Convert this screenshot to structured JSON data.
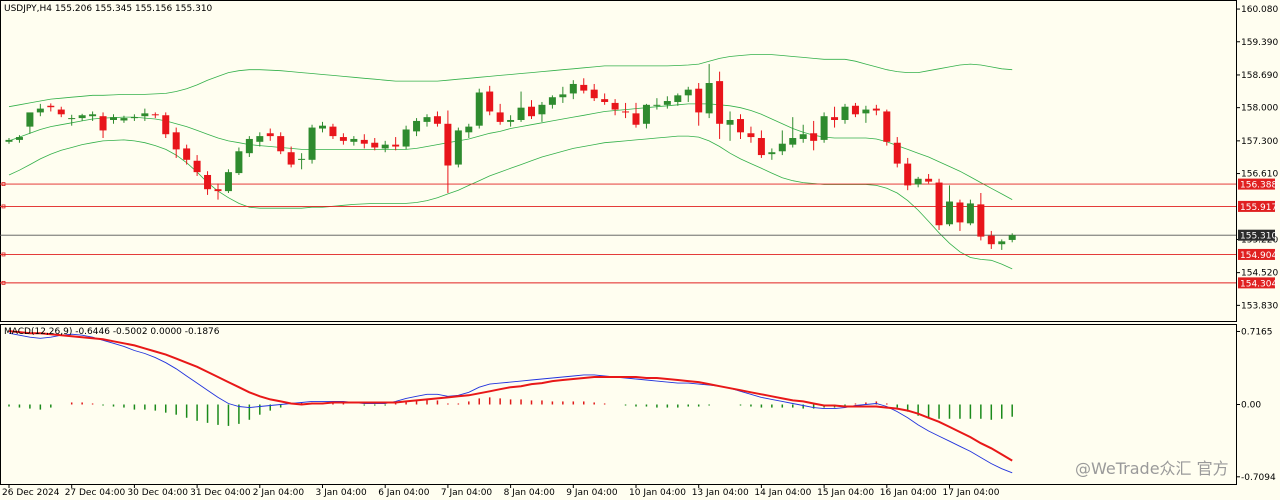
{
  "symbol_header": "USDJPY,H4  155.206 155.345 155.156 155.310",
  "macd_header": "MACD(12,26,9) -0.6446 -0.5002 0.0000 -0.1876",
  "watermark": "@WeTrade众汇 官方",
  "colors": {
    "background": "#fffef0",
    "bull": "#2e8b2e",
    "bear": "#e8151b",
    "band": "#33b04a",
    "level": "#e02020",
    "last_line": "#555555",
    "macd_main": "#2233dd",
    "macd_signal": "#e81818",
    "macd_hist": "#1a8a1a",
    "macd_hist_pos": "#e01818"
  },
  "chart_data": {
    "type": "candlestick",
    "price_axis": {
      "labels": [
        "160.080",
        "159.390",
        "158.690",
        "158.000",
        "157.300",
        "156.610",
        "155.220",
        "154.520",
        "153.830"
      ],
      "values": [
        160.08,
        159.39,
        158.69,
        158.0,
        157.3,
        156.61,
        155.22,
        154.52,
        153.83
      ],
      "range": [
        153.5,
        160.25
      ]
    },
    "time_labels": [
      "26 Dec 2024",
      "27 Dec 04:00",
      "30 Dec 04:00",
      "31 Dec 04:00",
      "2 Jan 04:00",
      "3 Jan 04:00",
      "6 Jan 04:00",
      "7 Jan 04:00",
      "8 Jan 04:00",
      "9 Jan 04:00",
      "10 Jan 04:00",
      "13 Jan 04:00",
      "14 Jan 04:00",
      "15 Jan 04:00",
      "16 Jan 04:00",
      "17 Jan 04:00"
    ],
    "candles": [
      [
        157.28,
        157.36,
        157.24,
        157.32
      ],
      [
        157.32,
        157.42,
        157.26,
        157.38
      ],
      [
        157.6,
        157.7,
        157.45,
        157.9
      ],
      [
        157.9,
        158.08,
        157.82,
        157.98
      ],
      [
        158.04,
        158.09,
        157.92,
        158.01
      ],
      [
        157.96,
        158.02,
        157.8,
        157.86
      ],
      [
        157.77,
        157.85,
        157.62,
        157.78
      ],
      [
        157.78,
        157.87,
        157.72,
        157.84
      ],
      [
        157.82,
        157.92,
        157.72,
        157.86
      ],
      [
        157.82,
        157.9,
        157.36,
        157.52
      ],
      [
        157.74,
        157.86,
        157.66,
        157.8
      ],
      [
        157.73,
        157.83,
        157.68,
        157.78
      ],
      [
        157.78,
        157.86,
        157.72,
        157.8
      ],
      [
        157.82,
        157.98,
        157.72,
        157.88
      ],
      [
        157.86,
        157.9,
        157.78,
        157.84
      ],
      [
        157.84,
        157.9,
        157.36,
        157.44
      ],
      [
        157.48,
        157.58,
        156.94,
        157.12
      ],
      [
        157.14,
        157.22,
        156.8,
        156.9
      ],
      [
        156.88,
        157.0,
        156.56,
        156.64
      ],
      [
        156.58,
        156.66,
        156.16,
        156.28
      ],
      [
        156.28,
        156.4,
        156.06,
        156.24
      ],
      [
        156.24,
        156.7,
        156.2,
        156.64
      ],
      [
        156.62,
        157.16,
        156.58,
        157.08
      ],
      [
        157.04,
        157.4,
        156.96,
        157.34
      ],
      [
        157.28,
        157.48,
        157.18,
        157.4
      ],
      [
        157.46,
        157.56,
        157.3,
        157.4
      ],
      [
        157.4,
        157.48,
        157.02,
        157.08
      ],
      [
        157.06,
        157.18,
        156.74,
        156.8
      ],
      [
        156.9,
        157.04,
        156.7,
        156.92
      ],
      [
        156.9,
        157.64,
        156.82,
        157.58
      ],
      [
        157.56,
        157.7,
        157.48,
        157.62
      ],
      [
        157.6,
        157.66,
        157.34,
        157.4
      ],
      [
        157.38,
        157.46,
        157.22,
        157.3
      ],
      [
        157.28,
        157.4,
        157.2,
        157.34
      ],
      [
        157.32,
        157.44,
        157.14,
        157.24
      ],
      [
        157.26,
        157.36,
        157.1,
        157.16
      ],
      [
        157.14,
        157.3,
        157.06,
        157.22
      ],
      [
        157.22,
        157.38,
        157.1,
        157.18
      ],
      [
        157.18,
        157.62,
        157.12,
        157.54
      ],
      [
        157.5,
        157.78,
        157.4,
        157.72
      ],
      [
        157.7,
        157.86,
        157.6,
        157.8
      ],
      [
        157.82,
        157.92,
        157.6,
        157.66
      ],
      [
        157.66,
        157.94,
        156.2,
        156.78
      ],
      [
        156.8,
        157.58,
        156.74,
        157.52
      ],
      [
        157.48,
        157.66,
        157.36,
        157.6
      ],
      [
        157.62,
        158.4,
        157.56,
        158.32
      ],
      [
        158.34,
        158.46,
        157.84,
        157.92
      ],
      [
        157.9,
        158.08,
        157.64,
        157.7
      ],
      [
        157.7,
        157.84,
        157.6,
        157.74
      ],
      [
        157.74,
        158.34,
        157.7,
        158.0
      ],
      [
        158.02,
        158.16,
        157.76,
        157.82
      ],
      [
        157.86,
        158.12,
        157.7,
        158.06
      ],
      [
        158.06,
        158.26,
        157.98,
        158.22
      ],
      [
        158.22,
        158.44,
        158.1,
        158.28
      ],
      [
        158.3,
        158.58,
        158.18,
        158.5
      ],
      [
        158.48,
        158.62,
        158.3,
        158.36
      ],
      [
        158.38,
        158.5,
        158.14,
        158.2
      ],
      [
        158.18,
        158.3,
        158.06,
        158.12
      ],
      [
        158.1,
        158.18,
        157.84,
        157.96
      ],
      [
        157.92,
        158.1,
        157.78,
        157.9
      ],
      [
        157.88,
        158.1,
        157.58,
        157.64
      ],
      [
        157.66,
        158.08,
        157.56,
        158.06
      ],
      [
        158.04,
        158.2,
        157.96,
        158.06
      ],
      [
        158.06,
        158.24,
        157.98,
        158.14
      ],
      [
        158.12,
        158.3,
        158.04,
        158.26
      ],
      [
        158.26,
        158.44,
        158.12,
        158.38
      ],
      [
        158.4,
        158.52,
        157.62,
        157.9
      ],
      [
        157.88,
        158.92,
        157.78,
        158.52
      ],
      [
        158.56,
        158.76,
        157.34,
        157.66
      ],
      [
        157.64,
        157.92,
        157.3,
        157.74
      ],
      [
        157.76,
        157.86,
        157.34,
        157.48
      ],
      [
        157.46,
        157.6,
        157.26,
        157.38
      ],
      [
        157.36,
        157.52,
        156.94,
        157.0
      ],
      [
        157.02,
        157.14,
        156.9,
        157.06
      ],
      [
        157.08,
        157.52,
        157.0,
        157.24
      ],
      [
        157.22,
        157.8,
        157.16,
        157.36
      ],
      [
        157.34,
        157.64,
        157.26,
        157.44
      ],
      [
        157.46,
        157.72,
        157.1,
        157.3
      ],
      [
        157.32,
        157.9,
        157.26,
        157.82
      ],
      [
        157.8,
        158.02,
        157.58,
        157.74
      ],
      [
        157.74,
        158.08,
        157.66,
        158.02
      ],
      [
        158.04,
        158.1,
        157.8,
        157.86
      ],
      [
        157.88,
        158.04,
        157.68,
        157.96
      ],
      [
        157.98,
        158.06,
        157.84,
        157.94
      ],
      [
        157.92,
        157.96,
        157.2,
        157.28
      ],
      [
        157.26,
        157.38,
        156.74,
        156.82
      ],
      [
        156.82,
        156.94,
        156.26,
        156.36
      ],
      [
        156.38,
        156.54,
        156.32,
        156.5
      ],
      [
        156.5,
        156.6,
        156.4,
        156.44
      ],
      [
        156.42,
        156.5,
        155.42,
        155.52
      ],
      [
        155.54,
        156.36,
        155.5,
        156.02
      ],
      [
        156.0,
        156.06,
        155.4,
        155.58
      ],
      [
        155.56,
        156.06,
        155.52,
        155.98
      ],
      [
        155.96,
        156.2,
        155.2,
        155.28
      ],
      [
        155.3,
        155.4,
        155.02,
        155.12
      ],
      [
        155.12,
        155.22,
        155.0,
        155.18
      ],
      [
        155.21,
        155.35,
        155.16,
        155.31
      ]
    ],
    "bollinger_bands": {
      "period": 20,
      "upper": [
        158.02,
        158.06,
        158.1,
        158.14,
        158.18,
        158.2,
        158.22,
        158.24,
        158.26,
        158.26,
        158.27,
        158.28,
        158.28,
        158.28,
        158.29,
        158.3,
        158.34,
        158.4,
        158.48,
        158.58,
        158.66,
        158.74,
        158.78,
        158.8,
        158.8,
        158.79,
        158.78,
        158.76,
        158.74,
        158.72,
        158.7,
        158.68,
        158.66,
        158.64,
        158.62,
        158.6,
        158.58,
        158.56,
        158.56,
        158.56,
        158.56,
        158.56,
        158.58,
        158.6,
        158.62,
        158.64,
        158.66,
        158.68,
        158.7,
        158.72,
        158.74,
        158.76,
        158.78,
        158.8,
        158.82,
        158.84,
        158.86,
        158.88,
        158.88,
        158.88,
        158.88,
        158.88,
        158.88,
        158.88,
        158.89,
        158.9,
        158.92,
        158.98,
        159.04,
        159.08,
        159.1,
        159.12,
        159.12,
        159.12,
        159.1,
        159.08,
        159.06,
        159.04,
        159.02,
        159.02,
        159.02,
        158.98,
        158.92,
        158.86,
        158.8,
        158.76,
        158.74,
        158.74,
        158.78,
        158.82,
        158.86,
        158.9,
        158.92,
        158.9,
        158.86,
        158.82,
        158.8
      ],
      "middle": [
        157.3,
        157.38,
        157.46,
        157.54,
        157.6,
        157.64,
        157.68,
        157.72,
        157.76,
        157.78,
        157.79,
        157.8,
        157.8,
        157.78,
        157.76,
        157.72,
        157.66,
        157.6,
        157.52,
        157.44,
        157.36,
        157.3,
        157.26,
        157.22,
        157.2,
        157.18,
        157.16,
        157.14,
        157.12,
        157.12,
        157.12,
        157.12,
        157.12,
        157.12,
        157.12,
        157.12,
        157.12,
        157.12,
        157.12,
        157.14,
        157.18,
        157.22,
        157.26,
        157.3,
        157.34,
        157.4,
        157.46,
        157.5,
        157.56,
        157.6,
        157.64,
        157.68,
        157.72,
        157.76,
        157.8,
        157.84,
        157.88,
        157.92,
        157.94,
        157.96,
        157.98,
        158.0,
        158.02,
        158.04,
        158.06,
        158.08,
        158.08,
        158.08,
        158.06,
        158.04,
        158.0,
        157.94,
        157.86,
        157.76,
        157.66,
        157.56,
        157.48,
        157.42,
        157.38,
        157.36,
        157.36,
        157.36,
        157.36,
        157.34,
        157.28,
        157.2,
        157.12,
        157.04,
        156.96,
        156.86,
        156.76,
        156.66,
        156.54,
        156.42,
        156.3,
        156.18,
        156.06
      ],
      "lower": [
        156.58,
        156.68,
        156.8,
        156.92,
        157.02,
        157.1,
        157.16,
        157.22,
        157.26,
        157.3,
        157.31,
        157.32,
        157.3,
        157.26,
        157.2,
        157.12,
        157.0,
        156.84,
        156.64,
        156.42,
        156.24,
        156.1,
        155.98,
        155.9,
        155.88,
        155.88,
        155.88,
        155.88,
        155.88,
        155.9,
        155.9,
        155.92,
        155.94,
        155.96,
        155.97,
        155.98,
        155.98,
        155.98,
        155.98,
        156.0,
        156.04,
        156.1,
        156.18,
        156.26,
        156.36,
        156.46,
        156.56,
        156.64,
        156.72,
        156.8,
        156.88,
        156.96,
        157.02,
        157.08,
        157.14,
        157.18,
        157.22,
        157.26,
        157.28,
        157.3,
        157.32,
        157.34,
        157.36,
        157.38,
        157.4,
        157.4,
        157.38,
        157.3,
        157.18,
        157.04,
        156.92,
        156.82,
        156.72,
        156.62,
        156.52,
        156.46,
        156.42,
        156.4,
        156.38,
        156.38,
        156.38,
        156.38,
        156.38,
        156.36,
        156.3,
        156.2,
        156.04,
        155.84,
        155.6,
        155.36,
        155.14,
        154.96,
        154.84,
        154.8,
        154.78,
        154.7,
        154.6
      ]
    },
    "levels": [
      {
        "value": 156.388,
        "label": "156.388"
      },
      {
        "value": 155.917,
        "label": "155.917"
      },
      {
        "value": 154.904,
        "label": "154.904"
      },
      {
        "value": 154.304,
        "label": "154.304"
      }
    ],
    "last_price": {
      "value": 155.31,
      "label": "155.310"
    },
    "macd": {
      "params": "12,26,9",
      "axis_labels": [
        "0.7165",
        "0.00",
        "-0.7094"
      ],
      "axis_values": [
        0.7165,
        0.0,
        -0.7094
      ],
      "range": [
        -0.78,
        0.78
      ],
      "main": [
        0.7,
        0.68,
        0.66,
        0.65,
        0.66,
        0.68,
        0.69,
        0.68,
        0.66,
        0.63,
        0.6,
        0.57,
        0.53,
        0.5,
        0.46,
        0.41,
        0.35,
        0.28,
        0.21,
        0.14,
        0.07,
        0.01,
        -0.02,
        -0.03,
        -0.02,
        -0.01,
        0.0,
        0.01,
        0.02,
        0.03,
        0.03,
        0.03,
        0.03,
        0.02,
        0.01,
        0.01,
        0.01,
        0.03,
        0.06,
        0.08,
        0.1,
        0.1,
        0.08,
        0.09,
        0.12,
        0.17,
        0.2,
        0.21,
        0.22,
        0.23,
        0.24,
        0.25,
        0.26,
        0.27,
        0.28,
        0.29,
        0.29,
        0.28,
        0.27,
        0.26,
        0.25,
        0.24,
        0.23,
        0.22,
        0.21,
        0.21,
        0.2,
        0.19,
        0.18,
        0.16,
        0.13,
        0.1,
        0.07,
        0.05,
        0.03,
        0.01,
        -0.01,
        -0.03,
        -0.04,
        -0.04,
        -0.03,
        -0.01,
        0.0,
        0.01,
        -0.02,
        -0.07,
        -0.13,
        -0.2,
        -0.26,
        -0.31,
        -0.36,
        -0.41,
        -0.46,
        -0.52,
        -0.58,
        -0.63,
        -0.67
      ],
      "signal": [
        0.72,
        0.71,
        0.7,
        0.7,
        0.69,
        0.68,
        0.67,
        0.66,
        0.65,
        0.64,
        0.62,
        0.6,
        0.58,
        0.55,
        0.52,
        0.49,
        0.45,
        0.41,
        0.37,
        0.32,
        0.27,
        0.22,
        0.17,
        0.12,
        0.08,
        0.05,
        0.03,
        0.01,
        0.0,
        0.01,
        0.01,
        0.02,
        0.02,
        0.02,
        0.02,
        0.02,
        0.02,
        0.02,
        0.03,
        0.04,
        0.05,
        0.06,
        0.07,
        0.08,
        0.09,
        0.11,
        0.13,
        0.15,
        0.17,
        0.18,
        0.2,
        0.21,
        0.23,
        0.24,
        0.25,
        0.26,
        0.27,
        0.27,
        0.27,
        0.27,
        0.27,
        0.26,
        0.26,
        0.25,
        0.24,
        0.23,
        0.22,
        0.2,
        0.18,
        0.16,
        0.14,
        0.12,
        0.1,
        0.08,
        0.06,
        0.04,
        0.03,
        0.01,
        -0.01,
        -0.01,
        -0.02,
        -0.02,
        -0.02,
        -0.02,
        -0.03,
        -0.04,
        -0.06,
        -0.09,
        -0.13,
        -0.17,
        -0.22,
        -0.27,
        -0.32,
        -0.38,
        -0.43,
        -0.49,
        -0.55
      ],
      "histogram": [
        -0.02,
        -0.03,
        -0.04,
        -0.05,
        -0.03,
        0.0,
        0.02,
        0.02,
        0.01,
        -0.01,
        -0.02,
        -0.03,
        -0.05,
        -0.05,
        -0.06,
        -0.08,
        -0.1,
        -0.13,
        -0.16,
        -0.18,
        -0.2,
        -0.21,
        -0.19,
        -0.15,
        -0.1,
        -0.06,
        -0.03,
        0.0,
        0.02,
        0.02,
        0.02,
        0.01,
        0.01,
        0.0,
        -0.01,
        -0.01,
        -0.01,
        0.01,
        0.03,
        0.04,
        0.05,
        0.04,
        0.01,
        0.01,
        0.03,
        0.06,
        0.07,
        0.06,
        0.05,
        0.05,
        0.04,
        0.04,
        0.03,
        0.03,
        0.03,
        0.03,
        0.02,
        0.01,
        0.0,
        -0.01,
        -0.02,
        -0.02,
        -0.03,
        -0.03,
        -0.03,
        -0.02,
        -0.02,
        -0.01,
        0.0,
        0.0,
        -0.01,
        -0.02,
        -0.03,
        -0.03,
        -0.03,
        -0.03,
        -0.04,
        -0.04,
        -0.03,
        -0.03,
        -0.01,
        0.01,
        0.02,
        0.03,
        0.01,
        -0.03,
        -0.07,
        -0.11,
        -0.13,
        -0.14,
        -0.14,
        -0.14,
        -0.14,
        -0.14,
        -0.15,
        -0.14,
        -0.12
      ]
    }
  }
}
